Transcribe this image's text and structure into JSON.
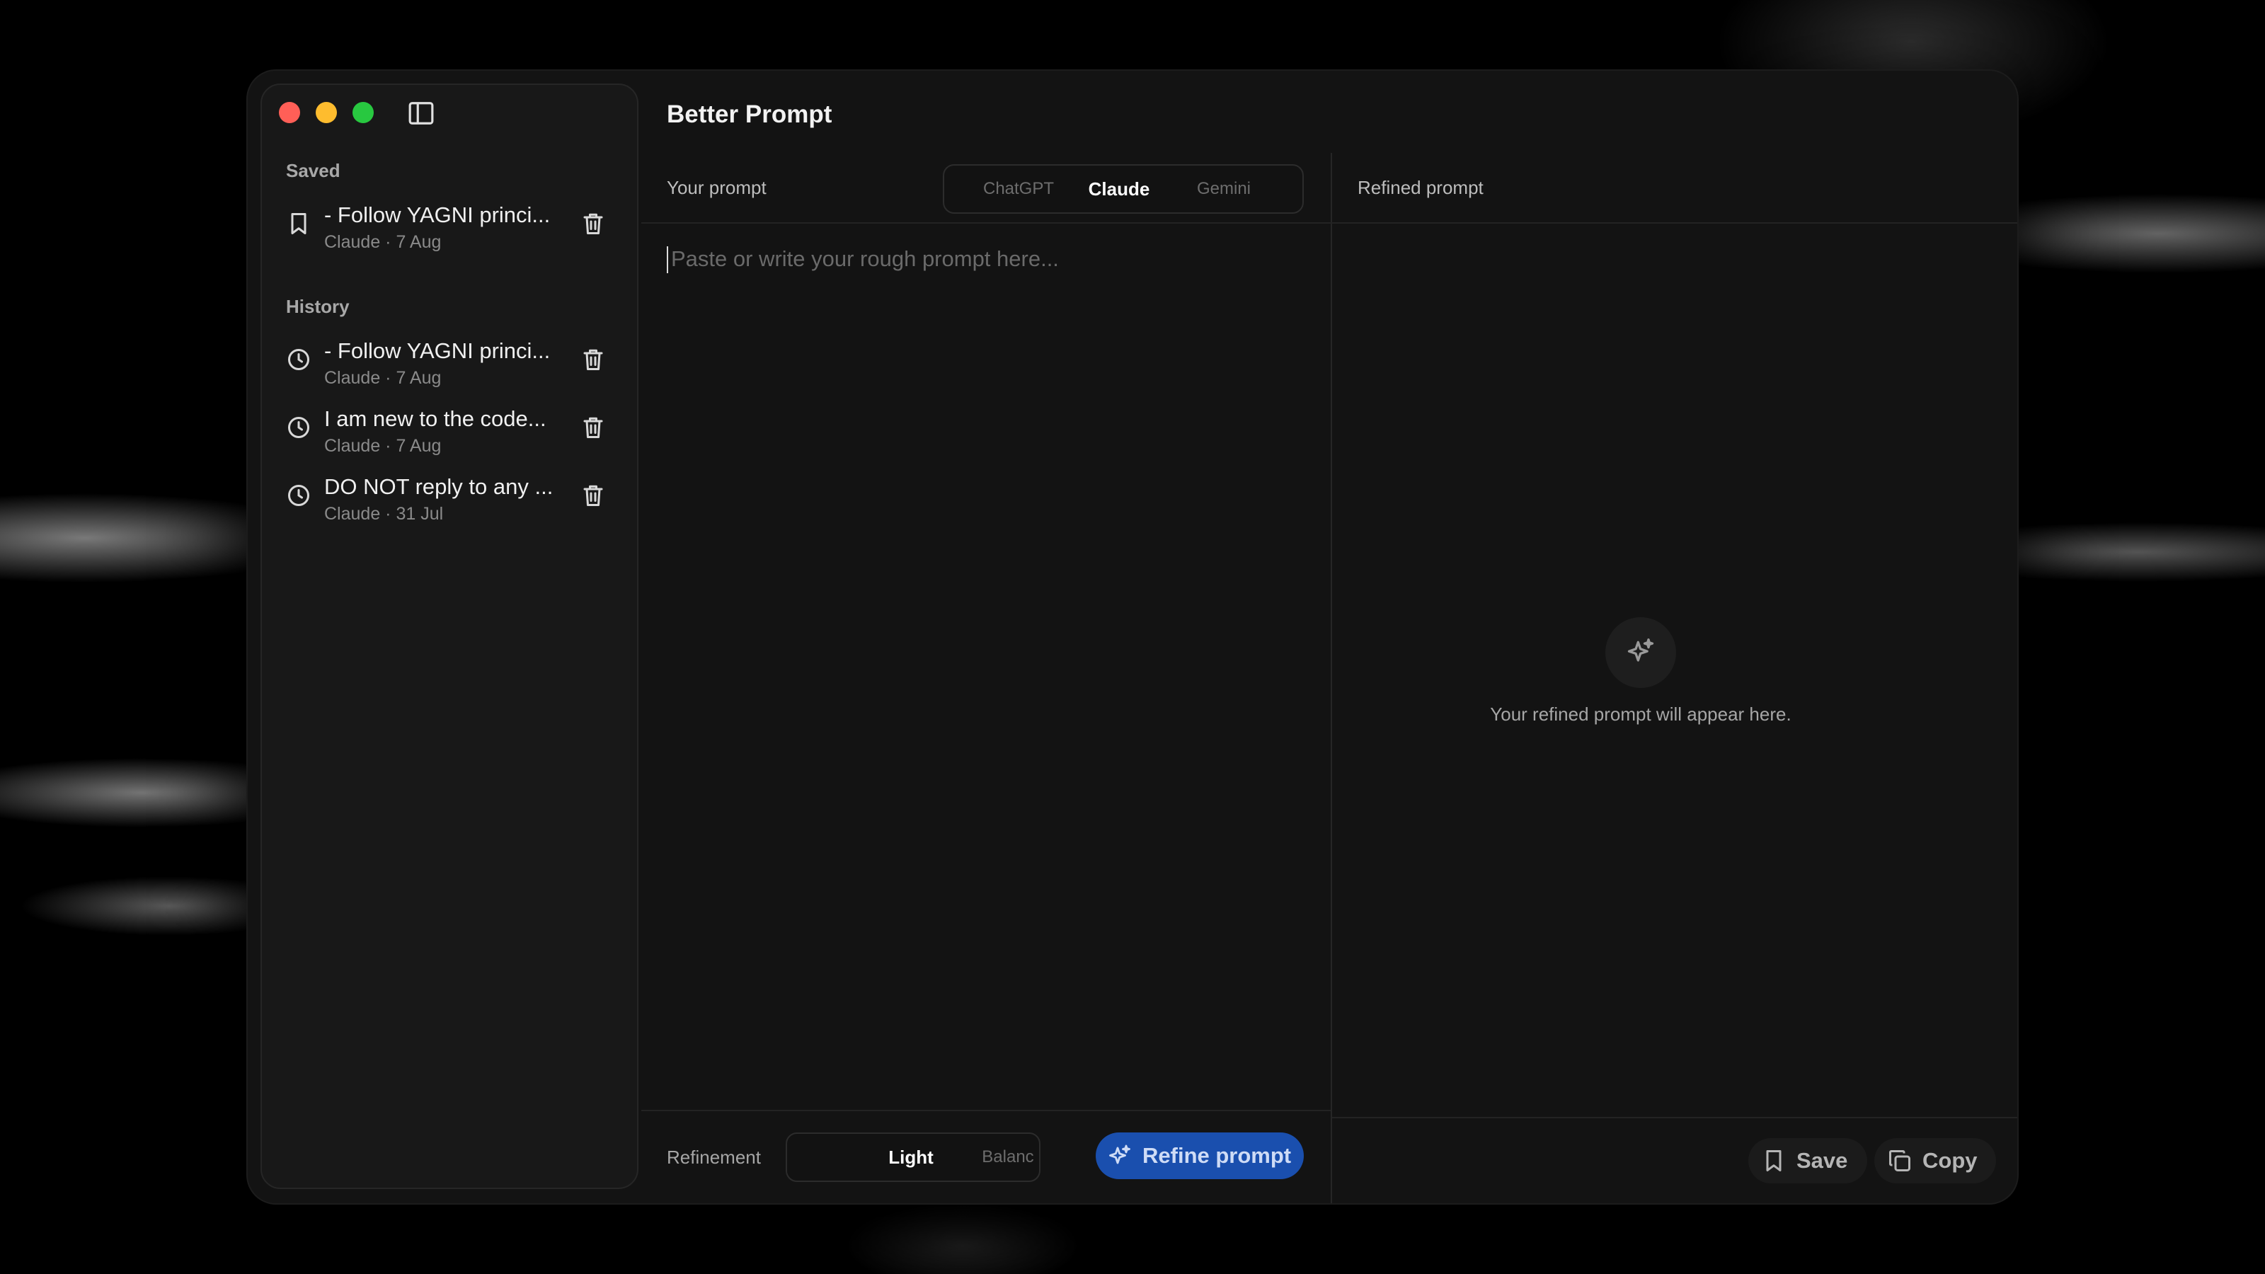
{
  "app": {
    "title": "Better Prompt"
  },
  "sidebar": {
    "saved_label": "Saved",
    "history_label": "History",
    "saved": [
      {
        "title": "- Follow YAGNI princi...",
        "meta": "Claude · 7 Aug",
        "icon": "bookmark-icon"
      }
    ],
    "history": [
      {
        "title": "- Follow YAGNI princi...",
        "meta": "Claude · 7 Aug",
        "icon": "clock-icon"
      },
      {
        "title": "I am new to the code...",
        "meta": "Claude · 7 Aug",
        "icon": "clock-icon"
      },
      {
        "title": "DO NOT reply to any ...",
        "meta": "Claude · 31 Jul",
        "icon": "clock-icon"
      }
    ]
  },
  "prompt_pane": {
    "label": "Your prompt",
    "placeholder": "Paste or write your rough prompt here...",
    "models": [
      "ChatGPT",
      "Claude",
      "Gemini"
    ],
    "selected_model": "Claude"
  },
  "refined_pane": {
    "label": "Refined prompt",
    "empty_text": "Your refined prompt will appear here."
  },
  "bottom": {
    "refinement_label": "Refinement",
    "levels": [
      "Light",
      "Balanc"
    ],
    "selected_level": "Light",
    "refine_button": "Refine prompt",
    "save_button": "Save",
    "copy_button": "Copy"
  },
  "colors": {
    "window_bg": "#131313",
    "sidebar_bg": "#181818",
    "accent": "#1a4fae",
    "close": "#ff5f57",
    "minimize": "#febc2e",
    "maximize": "#28c840"
  }
}
